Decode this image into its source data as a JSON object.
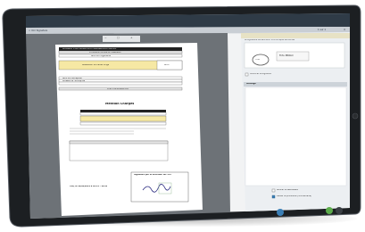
{
  "app": {
    "tab_label": "< Voir Signature",
    "page_indicator": "1 sur 1",
    "close_icon": "close-icon"
  },
  "toolbar": {
    "icons": [
      "zoom-out-icon",
      "page-icon",
      "zoom-in-icon"
    ]
  },
  "document": {
    "title_line1": "DEMANDE D'AUTORISATION D'ENSEIGNEMENT PARTIEL",
    "title_line2": "A COMPLETER PAR LE CANDIDAT",
    "section_organism": "Nom de l'organisme",
    "highlight_text": "Attestation de travail dirigé",
    "right_code": "BIS 2",
    "field_a": "Nom de l'entreprise",
    "field_b": "Adresse de l'entreprise",
    "section_footer": "VISA D'APPROBATION",
    "middle_title": "Mention Charges",
    "signature_date": "Fait, le 10/06/2021 à 10:45 - 12:00",
    "signature_label": "Signature par le directeur de l'IUT"
  },
  "panel": {
    "instruction": "Le signataire déclare avoir lu et accepté les termes",
    "stamp_text": "Tirtu",
    "signature_name": "Tirtu PROLO",
    "checkbox_certify": "Certificat de signature",
    "messages_header": "Message",
    "option_notify": "Notifier le destinataire",
    "option_validate": "Valider la procédure (commentaire)"
  },
  "colors": {
    "accent": "#3b7fb6",
    "app_bar": "#2e3a46",
    "highlight": "#f6e8a4",
    "table_dark": "#222222",
    "button_green": "#5cab4b"
  }
}
